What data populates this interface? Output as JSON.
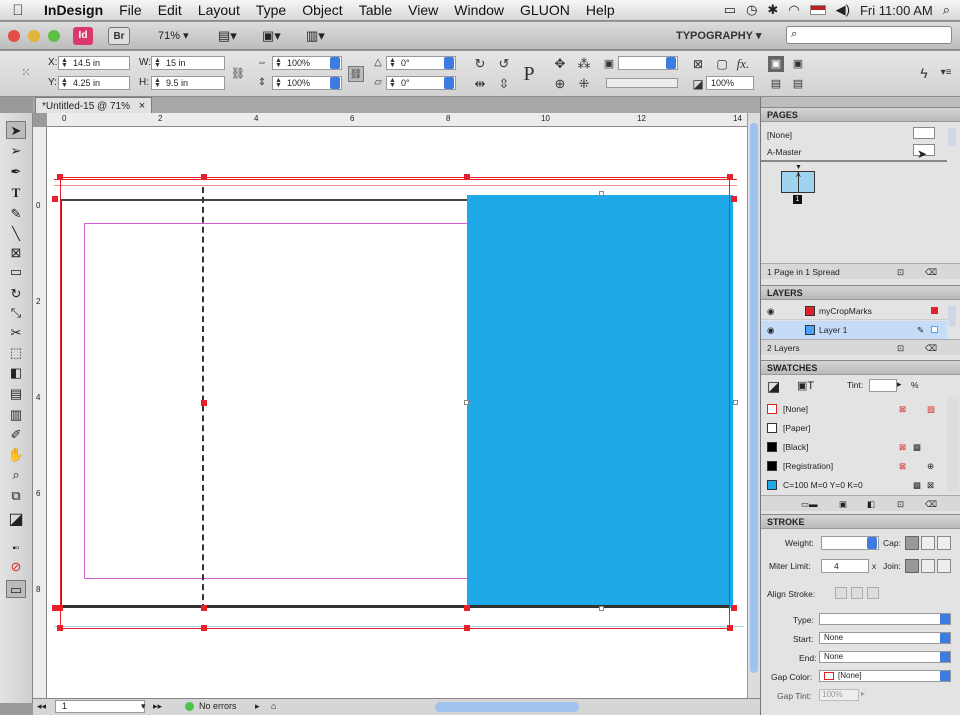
{
  "menubar": {
    "apple": "",
    "app_name": "InDesign",
    "items": [
      "File",
      "Edit",
      "Layout",
      "Type",
      "Object",
      "Table",
      "View",
      "Window",
      "GLUON",
      "Help"
    ],
    "clock": "Fri 11:00 AM"
  },
  "appbar": {
    "id_label": "Id",
    "br_label": "Br",
    "zoom": "71%",
    "workspace": "TYPOGRAPHY ▾",
    "search_placeholder": ""
  },
  "control": {
    "x_label": "X:",
    "x_value": "14.5 in",
    "y_label": "Y:",
    "y_value": "4.25 in",
    "w_label": "W:",
    "w_value": "15 in",
    "h_label": "H:",
    "h_value": "9.5 in",
    "scale_x": "100%",
    "scale_y": "100%",
    "angle": "0°",
    "shear": "0°",
    "opacity": "100%",
    "p_icon": "P"
  },
  "document": {
    "tab_title": "*Untitled-15 @ 71%",
    "close_glyph": "×"
  },
  "rulers": {
    "h_ticks": [
      "0",
      "2",
      "4",
      "6",
      "8",
      "10",
      "12",
      "14"
    ],
    "v_ticks": [
      "0",
      "2",
      "4",
      "6",
      "8"
    ]
  },
  "status": {
    "page": "1",
    "errors": "No errors"
  },
  "pages_panel": {
    "title": "PAGES",
    "none_label": "[None]",
    "master_label": "A-Master",
    "page_num": "1",
    "master_letter": "A",
    "footer": "1 Page in 1 Spread"
  },
  "layers_panel": {
    "title": "LAYERS",
    "layers": [
      {
        "name": "myCropMarks",
        "color": "#e0202a"
      },
      {
        "name": "Layer 1",
        "color": "#4aa3ff"
      }
    ],
    "footer": "2 Layers"
  },
  "swatches_panel": {
    "title": "SWATCHES",
    "tint_label": "Tint:",
    "tint_unit": "%",
    "swatches": [
      {
        "name": "[None]",
        "color": "#ffffff"
      },
      {
        "name": "[Paper]",
        "color": "#ffffff"
      },
      {
        "name": "[Black]",
        "color": "#000000"
      },
      {
        "name": "[Registration]",
        "color": "#000000"
      },
      {
        "name": "C=100 M=0 Y=0 K=0",
        "color": "#1fa9e9"
      }
    ]
  },
  "stroke_panel": {
    "title": "STROKE",
    "weight_label": "Weight:",
    "cap_label": "Cap:",
    "miter_label": "Miter Limit:",
    "miter_value": "4",
    "times": "x",
    "join_label": "Join:",
    "align_label": "Align Stroke:",
    "type_label": "Type:",
    "start_label": "Start:",
    "start_value": "None",
    "end_label": "End:",
    "end_value": "None",
    "gapcolor_label": "Gap Color:",
    "gapcolor_value": "[None]",
    "gaptint_label": "Gap Tint:",
    "gaptint_value": "100%"
  },
  "colors": {
    "fill_cyan": "#1fa9e9",
    "margin_magenta": "#d65cd6",
    "frame_red": "#e8202a"
  }
}
